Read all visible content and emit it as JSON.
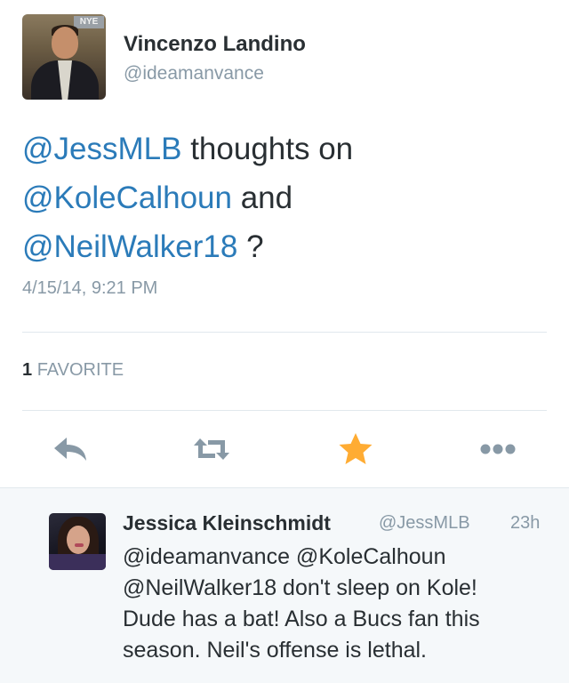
{
  "tweet": {
    "author_name": "Vincenzo Landino",
    "author_handle": "@ideamanvance",
    "avatar_sign_text": "NYE",
    "text_lines": [
      [
        {
          "t": "@JessMLB",
          "mention": true
        },
        {
          "t": " thoughts on",
          "mention": false
        }
      ],
      [
        {
          "t": "@KoleCalhoun",
          "mention": true
        },
        {
          "t": " and",
          "mention": false
        }
      ],
      [
        {
          "t": "@NeilWalker18",
          "mention": true
        },
        {
          "t": " ?",
          "mention": false
        }
      ]
    ],
    "timestamp": "4/15/14, 9:21 PM",
    "favorite_count": "1",
    "favorite_label": "FAVORITE"
  },
  "actions": {
    "reply_icon": "reply-icon",
    "retweet_icon": "retweet-icon",
    "favorite_icon": "star-icon",
    "more_icon": "more-dots-icon"
  },
  "reply": {
    "author_name": "Jessica Kleinschmidt",
    "author_handle": "@JessMLB",
    "time": "23h",
    "text_lines": [
      "@ideamanvance @KoleCalhoun",
      "@NeilWalker18 don't sleep on Kole!",
      "Dude has a bat! Also a Bucs fan this",
      "season. Neil's offense is lethal."
    ]
  },
  "colors": {
    "mention": "#2b7bb9",
    "secondary_text": "#8899a6",
    "favorite_star": "#ffac33",
    "icon_gray": "#8899a6",
    "reply_background": "#f5f8fa"
  }
}
